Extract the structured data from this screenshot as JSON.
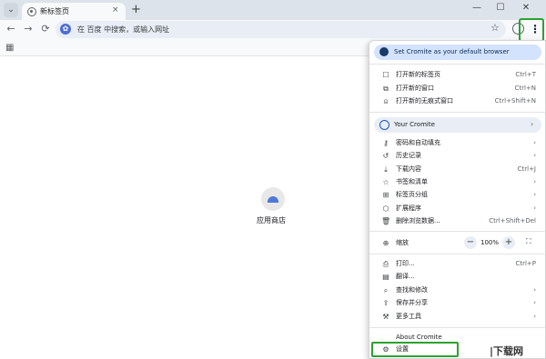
{
  "tab": {
    "title": "新标签页",
    "close": "×",
    "new": "+",
    "list": "⌄"
  },
  "window": {
    "minimize": "—",
    "maximize": "☐",
    "close": "✕"
  },
  "toolbar": {
    "back": "←",
    "forward": "→",
    "reload": "⟳",
    "omnibox_placeholder": "在 百度 中搜索，或输入网址",
    "search_engine_icon": "✿",
    "bookmark_star": "☆",
    "menu": "⋮"
  },
  "bookmarks": {
    "apps": "▦"
  },
  "page": {
    "store_label": "应用商店"
  },
  "menu": {
    "default_browser": "Set Cromite as your default browser",
    "group1": [
      {
        "icon": "☐",
        "label": "打开新的标签页",
        "shortcut": "Ctrl+T"
      },
      {
        "icon": "⧉",
        "label": "打开新的窗口",
        "shortcut": "Ctrl+N"
      },
      {
        "icon": "⍝",
        "label": "打开新的无痕式窗口",
        "shortcut": "Ctrl+Shift+N"
      }
    ],
    "your_cromite": "Your Cromite",
    "your_arrow": "›",
    "group2": [
      {
        "icon": "⚷",
        "label": "密码和自动填充",
        "shortcut": "›"
      },
      {
        "icon": "↺",
        "label": "历史记录",
        "shortcut": "›"
      },
      {
        "icon": "⤓",
        "label": "下载内容",
        "shortcut": "Ctrl+J"
      },
      {
        "icon": "☆",
        "label": "书签和清单",
        "shortcut": "›"
      },
      {
        "icon": "⊞",
        "label": "标签页分组",
        "shortcut": "›"
      },
      {
        "icon": "⬡",
        "label": "扩展程序",
        "shortcut": "›"
      },
      {
        "icon": "🗑",
        "label": "删除浏览数据...",
        "shortcut": "Ctrl+Shift+Del"
      }
    ],
    "zoom": {
      "icon": "⊕",
      "label": "缩放",
      "minus": "−",
      "value": "100%",
      "plus": "+",
      "fullscreen": "⛶"
    },
    "group3": [
      {
        "icon": "⎙",
        "label": "打印...",
        "shortcut": "Ctrl+P"
      },
      {
        "icon": "▤",
        "label": "翻译...",
        "shortcut": ""
      },
      {
        "icon": "⌕",
        "label": "查找和修改",
        "shortcut": "›"
      },
      {
        "icon": "⇪",
        "label": "保存并分享",
        "shortcut": "›"
      },
      {
        "icon": "⚒",
        "label": "更多工具",
        "shortcut": "›"
      }
    ],
    "group4": [
      {
        "icon": "",
        "label": "About Cromite",
        "shortcut": ""
      },
      {
        "icon": "⚙",
        "label": "设置",
        "shortcut": ""
      }
    ]
  },
  "watermark": "|下载网"
}
